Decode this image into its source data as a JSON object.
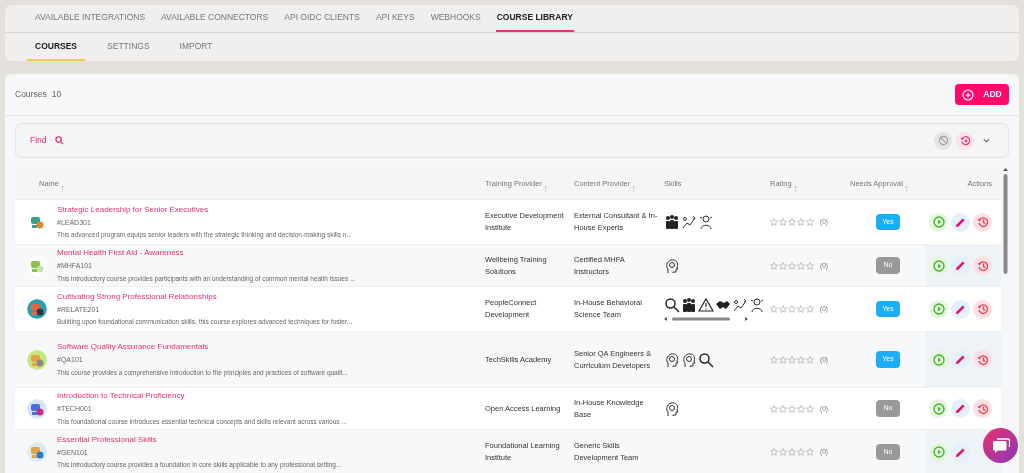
{
  "tabs": [
    {
      "label": "AVAILABLE INTEGRATIONS",
      "selected": false
    },
    {
      "label": "AVAILABLE CONNECTORS",
      "selected": false
    },
    {
      "label": "API OIDC CLIENTS",
      "selected": false
    },
    {
      "label": "API KEYS",
      "selected": false
    },
    {
      "label": "WEBHOOKS",
      "selected": false
    },
    {
      "label": "COURSE LIBRARY",
      "selected": true
    }
  ],
  "subtabs": [
    {
      "label": "COURSES",
      "selected": true
    },
    {
      "label": "SETTINGS",
      "selected": false
    },
    {
      "label": "IMPORT",
      "selected": false
    }
  ],
  "courses_label": "Courses",
  "courses_count": "10",
  "add_button": "ADD",
  "find_label": "Find",
  "columns": [
    "Name",
    "Training Provider",
    "Content Provider",
    "Skills",
    "Rating",
    "Needs Approval",
    "Actions"
  ],
  "rows": [
    {
      "title": "Strategic Leadership for Senior Executives",
      "code": "#LEAD301",
      "description": "This advanced program equips senior leaders with the strategic thinking and decision-making skills n...",
      "training_provider": "Executive Development Institute",
      "content_provider": "External Consultant & In-House Experts",
      "skills": [
        {
          "kind": "team"
        },
        {
          "kind": "growth"
        },
        {
          "kind": "person"
        }
      ],
      "stars": 0,
      "rating_count": "(0)",
      "approval": {
        "label": "Yes",
        "on": true
      },
      "actions": [
        {
          "kind": "play"
        },
        {
          "kind": "edit"
        },
        {
          "kind": "history"
        }
      ]
    },
    {
      "title": "Mental Health First Aid - Awareness",
      "code": "#MHFA101",
      "description": "This introductory course provides participants with an understanding of common mental health issues ...",
      "training_provider": "Wellbeing Training Solutions",
      "content_provider": "Certified MHFA Instructors",
      "skills": [
        {
          "kind": "head"
        }
      ],
      "stars": 0,
      "rating_count": "(0)",
      "approval": {
        "label": "No",
        "on": false
      },
      "actions": [
        {
          "kind": "play"
        },
        {
          "kind": "edit"
        },
        {
          "kind": "history"
        }
      ]
    },
    {
      "title": "Cultivating Strong Professional Relationships",
      "code": "#RELATE201",
      "description": "Building upon foundational communication skills, this course explores advanced techniques for foster...",
      "training_provider": "PeopleConnect Development",
      "content_provider": "In-House Behavioral Science Team",
      "skills": [
        {
          "kind": "search"
        },
        {
          "kind": "team"
        },
        {
          "kind": "warning"
        },
        {
          "kind": "handshake"
        },
        {
          "kind": "growth"
        },
        {
          "kind": "person"
        }
      ],
      "stars": 0,
      "rating_count": "(0)",
      "approval": {
        "label": "Yes",
        "on": true
      },
      "actions": [
        {
          "kind": "play"
        },
        {
          "kind": "edit"
        },
        {
          "kind": "history"
        }
      ]
    },
    {
      "title": "Software Quality Assurance Fundamentals",
      "code": "#QA101",
      "description": "This course provides a comprehensive introduction to the principles and practices of software qualit...",
      "training_provider": "TechSkills Academy",
      "content_provider": "Senior QA Engineers & Curriculum Developers",
      "skills": [
        {
          "kind": "head"
        },
        {
          "kind": "head"
        },
        {
          "kind": "search"
        }
      ],
      "stars": 0,
      "rating_count": "(0)",
      "approval": {
        "label": "Yes",
        "on": true
      },
      "actions": [
        {
          "kind": "play"
        },
        {
          "kind": "edit"
        },
        {
          "kind": "history"
        }
      ]
    },
    {
      "title": "Introduction to Technical Proficiency",
      "code": "#TECH001",
      "description": "This foundational course introduces essential technical concepts and skills relevant across various ...",
      "training_provider": "Open Access Learning",
      "content_provider": "In-House Knowledge Base",
      "skills": [
        {
          "kind": "head"
        }
      ],
      "stars": 0,
      "rating_count": "(0)",
      "approval": {
        "label": "No",
        "on": false
      },
      "actions": [
        {
          "kind": "play"
        },
        {
          "kind": "edit"
        },
        {
          "kind": "history"
        }
      ]
    },
    {
      "title": "Essential Professional Skills",
      "code": "#GEN101",
      "description": "This introductory course provides a foundation in core skills applicable to any professional setting...",
      "training_provider": "Foundational Learning Institute",
      "content_provider": "Generic Skills Development Team",
      "skills": [],
      "stars": 0,
      "rating_count": "(0)",
      "approval": {
        "label": "No",
        "on": false
      },
      "actions": [
        {
          "kind": "play"
        },
        {
          "kind": "edit"
        }
      ]
    }
  ]
}
